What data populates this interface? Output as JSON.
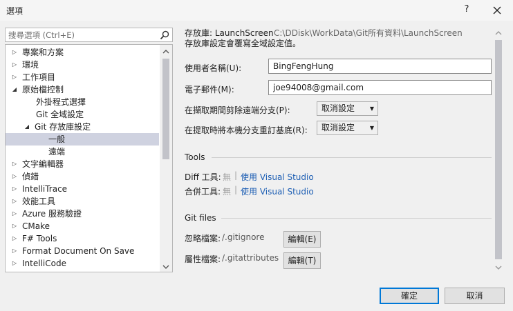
{
  "window": {
    "title": "選項",
    "help_label": "?",
    "close_icon": "close-icon"
  },
  "search": {
    "placeholder": "搜尋選項 (Ctrl+E)",
    "icon": "search-icon"
  },
  "tree": {
    "items": [
      {
        "label": "專案和方案",
        "state": "collapsed"
      },
      {
        "label": "環境",
        "state": "collapsed"
      },
      {
        "label": "工作項目",
        "state": "collapsed"
      },
      {
        "label": "原始檔控制",
        "state": "expanded"
      },
      {
        "label": "外掛程式選擇",
        "state": "leaf"
      },
      {
        "label": "Git 全域設定",
        "state": "leaf"
      },
      {
        "label": "Git 存放庫設定",
        "state": "expanded"
      },
      {
        "label": "一般",
        "state": "leaf",
        "selected": true
      },
      {
        "label": "遠端",
        "state": "leaf"
      },
      {
        "label": "文字編輯器",
        "state": "collapsed"
      },
      {
        "label": "偵錯",
        "state": "collapsed"
      },
      {
        "label": "IntelliTrace",
        "state": "collapsed"
      },
      {
        "label": "效能工具",
        "state": "collapsed"
      },
      {
        "label": "Azure 服務驗證",
        "state": "collapsed"
      },
      {
        "label": "CMake",
        "state": "collapsed"
      },
      {
        "label": "F# Tools",
        "state": "collapsed"
      },
      {
        "label": "Format Document On Save",
        "state": "collapsed"
      },
      {
        "label": "IntelliCode",
        "state": "collapsed"
      }
    ]
  },
  "panel": {
    "repo_prefix": "存放庫: LaunchScreen",
    "repo_path": "C:\\DDisk\\WorkData\\Git所有資料\\LaunchScreen",
    "repo_note": "存放庫設定會覆寫全域設定值。",
    "username_label": "使用者名稱(U):",
    "username_value": "BingFengHung",
    "email_label": "電子郵件(M):",
    "email_value": "joe94008@gmail.com",
    "prune_label": "在擷取期間剪除遠端分支(P):",
    "prune_value": "取消設定",
    "rebase_label": "在提取時將本機分支重訂基底(R):",
    "rebase_value": "取消設定",
    "tools_header": "Tools",
    "diff_label": "Diff 工具:",
    "diff_none": "無",
    "diff_link": "使用 Visual Studio",
    "merge_label": "合併工具:",
    "merge_none": "無",
    "merge_link": "使用 Visual Studio",
    "gitfiles_header": "Git files",
    "ignore_label": "忽略檔案:",
    "ignore_value": "/.gitignore",
    "ignore_edit": "編輯(E)",
    "attr_label": "屬性檔案:",
    "attr_value": "/.gitattributes",
    "attr_edit": "編輯(T)"
  },
  "footer": {
    "ok_label": "確定",
    "cancel_label": "取消"
  },
  "colors": {
    "link": "#1e5fb4",
    "selection": "#cfd2e0",
    "focus_border": "#0078d7"
  }
}
